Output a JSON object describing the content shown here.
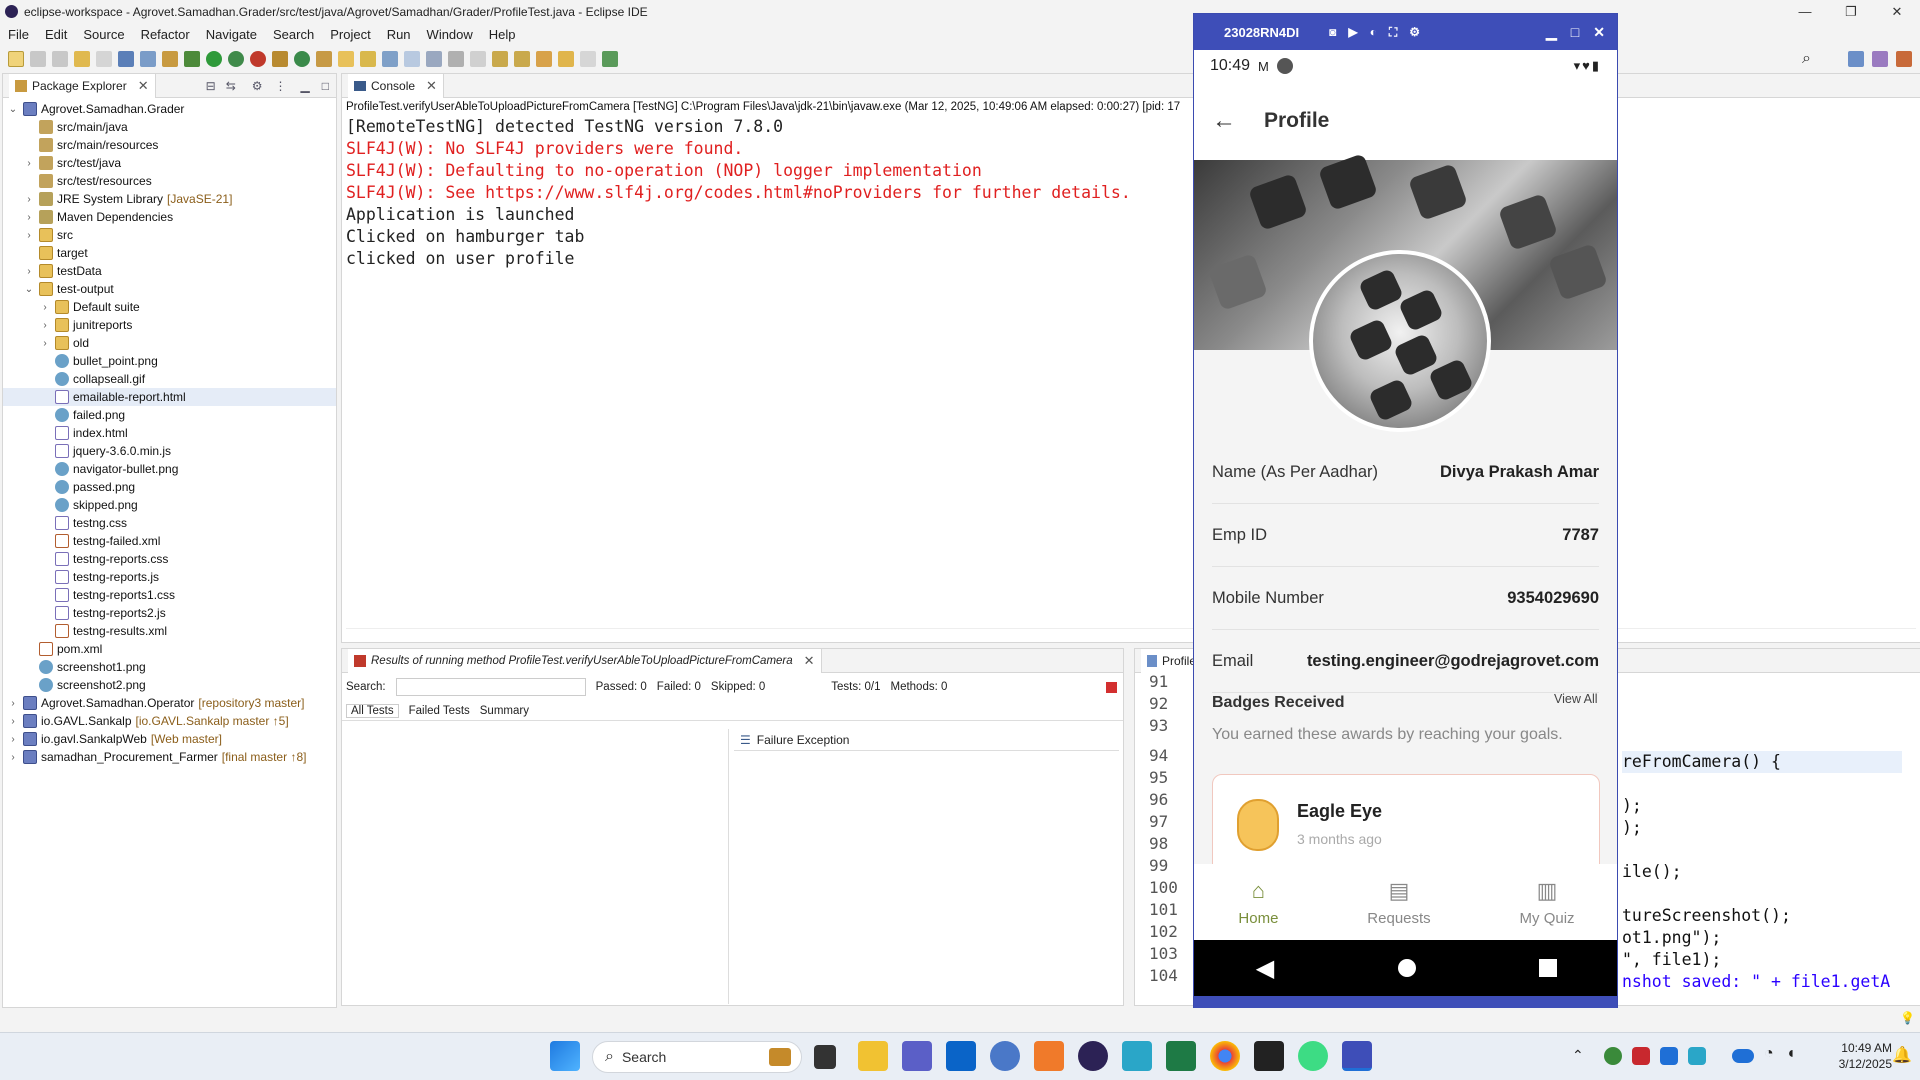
{
  "window": {
    "title": "eclipse-workspace - Agrovet.Samadhan.Grader/src/test/java/Agrovet/Samadhan/Grader/ProfileTest.java - Eclipse IDE",
    "min": "—",
    "max": "❐",
    "close": "✕"
  },
  "menu": [
    "File",
    "Edit",
    "Source",
    "Refactor",
    "Navigate",
    "Search",
    "Project",
    "Run",
    "Window",
    "Help"
  ],
  "package_explorer": {
    "title": "Package Explorer",
    "items": [
      {
        "label": "Agrovet.Samadhan.Grader",
        "deco": "",
        "depth": 0,
        "arrow": "⌄",
        "icon": "proj"
      },
      {
        "label": "src/main/java",
        "deco": "",
        "depth": 1,
        "arrow": "",
        "icon": "pkg"
      },
      {
        "label": "src/main/resources",
        "deco": "",
        "depth": 1,
        "arrow": "",
        "icon": "pkg"
      },
      {
        "label": "src/test/java",
        "deco": "",
        "depth": 1,
        "arrow": "›",
        "icon": "pkg"
      },
      {
        "label": "src/test/resources",
        "deco": "",
        "depth": 1,
        "arrow": "",
        "icon": "pkg"
      },
      {
        "label": "JRE System Library",
        "deco": "[JavaSE-21]",
        "depth": 1,
        "arrow": "›",
        "icon": "jar"
      },
      {
        "label": "Maven Dependencies",
        "deco": "",
        "depth": 1,
        "arrow": "›",
        "icon": "jar"
      },
      {
        "label": "src",
        "deco": "",
        "depth": 1,
        "arrow": "›",
        "icon": "folder"
      },
      {
        "label": "target",
        "deco": "",
        "depth": 1,
        "arrow": "",
        "icon": "folder"
      },
      {
        "label": "testData",
        "deco": "",
        "depth": 1,
        "arrow": "›",
        "icon": "folder"
      },
      {
        "label": "test-output",
        "deco": "",
        "depth": 1,
        "arrow": "⌄",
        "icon": "folder"
      },
      {
        "label": "Default suite",
        "deco": "",
        "depth": 2,
        "arrow": "›",
        "icon": "folder"
      },
      {
        "label": "junitreports",
        "deco": "",
        "depth": 2,
        "arrow": "›",
        "icon": "folder"
      },
      {
        "label": "old",
        "deco": "",
        "depth": 2,
        "arrow": "›",
        "icon": "folder"
      },
      {
        "label": "bullet_point.png",
        "deco": "",
        "depth": 2,
        "arrow": "",
        "icon": "globe"
      },
      {
        "label": "collapseall.gif",
        "deco": "",
        "depth": 2,
        "arrow": "",
        "icon": "globe"
      },
      {
        "label": "emailable-report.html",
        "deco": "",
        "depth": 2,
        "arrow": "",
        "icon": "htmlf"
      },
      {
        "label": "failed.png",
        "deco": "",
        "depth": 2,
        "arrow": "",
        "icon": "globe"
      },
      {
        "label": "index.html",
        "deco": "",
        "depth": 2,
        "arrow": "",
        "icon": "htmlf"
      },
      {
        "label": "jquery-3.6.0.min.js",
        "deco": "",
        "depth": 2,
        "arrow": "",
        "icon": "htmlf"
      },
      {
        "label": "navigator-bullet.png",
        "deco": "",
        "depth": 2,
        "arrow": "",
        "icon": "globe"
      },
      {
        "label": "passed.png",
        "deco": "",
        "depth": 2,
        "arrow": "",
        "icon": "globe"
      },
      {
        "label": "skipped.png",
        "deco": "",
        "depth": 2,
        "arrow": "",
        "icon": "globe"
      },
      {
        "label": "testng.css",
        "deco": "",
        "depth": 2,
        "arrow": "",
        "icon": "htmlf"
      },
      {
        "label": "testng-failed.xml",
        "deco": "",
        "depth": 2,
        "arrow": "",
        "icon": "xmlf"
      },
      {
        "label": "testng-reports.css",
        "deco": "",
        "depth": 2,
        "arrow": "",
        "icon": "htmlf"
      },
      {
        "label": "testng-reports.js",
        "deco": "",
        "depth": 2,
        "arrow": "",
        "icon": "htmlf"
      },
      {
        "label": "testng-reports1.css",
        "deco": "",
        "depth": 2,
        "arrow": "",
        "icon": "htmlf"
      },
      {
        "label": "testng-reports2.js",
        "deco": "",
        "depth": 2,
        "arrow": "",
        "icon": "htmlf"
      },
      {
        "label": "testng-results.xml",
        "deco": "",
        "depth": 2,
        "arrow": "",
        "icon": "xmlf"
      },
      {
        "label": "pom.xml",
        "deco": "",
        "depth": 1,
        "arrow": "",
        "icon": "xmlf"
      },
      {
        "label": "screenshot1.png",
        "deco": "",
        "depth": 1,
        "arrow": "",
        "icon": "globe"
      },
      {
        "label": "screenshot2.png",
        "deco": "",
        "depth": 1,
        "arrow": "",
        "icon": "globe"
      },
      {
        "label": "Agrovet.Samadhan.Operator",
        "deco": "[repository3 master]",
        "depth": 0,
        "arrow": "›",
        "icon": "proj"
      },
      {
        "label": "io.GAVL.Sankalp",
        "deco": "[io.GAVL.Sankalp master ↑5]",
        "depth": 0,
        "arrow": "›",
        "icon": "proj"
      },
      {
        "label": "io.gavl.SankalpWeb",
        "deco": "[Web master]",
        "depth": 0,
        "arrow": "›",
        "icon": "proj"
      },
      {
        "label": "samadhan_Procurement_Farmer",
        "deco": "[final master ↑8]",
        "depth": 0,
        "arrow": "›",
        "icon": "proj"
      }
    ]
  },
  "console": {
    "title": "Console",
    "command": "ProfileTest.verifyUserAbleToUploadPictureFromCamera [TestNG] C:\\Program Files\\Java\\jdk-21\\bin\\javaw.exe  (Mar 12, 2025, 10:49:06 AM elapsed: 0:00:27) [pid: 17",
    "lines": [
      {
        "text": "[RemoteTestNG] detected TestNG version 7.8.0",
        "err": false
      },
      {
        "text": "SLF4J(W): No SLF4J providers were found.",
        "err": true
      },
      {
        "text": "SLF4J(W): Defaulting to no-operation (NOP) logger implementation",
        "err": true
      },
      {
        "text": "SLF4J(W): See https://www.slf4j.org/codes.html#noProviders for further details.",
        "err": true
      },
      {
        "text": "Application is launched",
        "err": false
      },
      {
        "text": "Clicked on hamburger tab",
        "err": false
      },
      {
        "text": "clicked on user profile",
        "err": false
      }
    ]
  },
  "results": {
    "title": "Results of running method ProfileTest.verifyUserAbleToUploadPictureFromCamera",
    "search_label": "Search:",
    "passed": "Passed: 0",
    "failed": "Failed: 0",
    "skipped": "Skipped: 0",
    "tests": "Tests: 0/1",
    "methods": "Methods: 0",
    "tabs": [
      "All Tests",
      "Failed Tests",
      "Summary"
    ],
    "failure_title": "Failure Exception"
  },
  "editor": {
    "tab": "Profile",
    "line_numbers": [
      "91",
      "92",
      "93",
      "94",
      "95",
      "96",
      "97",
      "98",
      "99",
      "100",
      "101",
      "102",
      "103",
      "104"
    ],
    "code_fragments": [
      "reFromCamera() {",
      ");",
      ");",
      "ile();",
      "tureScreenshot();",
      "ot1.png\");",
      "\", file1);",
      "nshot saved: \" + file1.getA"
    ]
  },
  "phone": {
    "device": "23028RN4DI",
    "time": "10:49",
    "status_right": "▾♥▮",
    "screen_title": "Profile",
    "fields": [
      {
        "label": "Name (As Per Aadhar)",
        "value": "Divya Prakash Amar"
      },
      {
        "label": "Emp ID",
        "value": "7787"
      },
      {
        "label": "Mobile Number",
        "value": "9354029690"
      },
      {
        "label": "Email",
        "value": "testing.engineer@godrejagrovet.com"
      }
    ],
    "badges_title": "Badges Received",
    "view_all": "View All",
    "badges_subtitle": "You earned these awards by reaching your goals.",
    "badge": {
      "name": "Eagle Eye",
      "time": "3 months ago"
    },
    "nav": [
      {
        "label": "Home",
        "active": true
      },
      {
        "label": "Requests",
        "active": false
      },
      {
        "label": "My Quiz",
        "active": false
      }
    ],
    "accent": "#3e4eb8"
  },
  "taskbar": {
    "search": "Search",
    "time": "10:49 AM",
    "date": "3/12/2025"
  }
}
